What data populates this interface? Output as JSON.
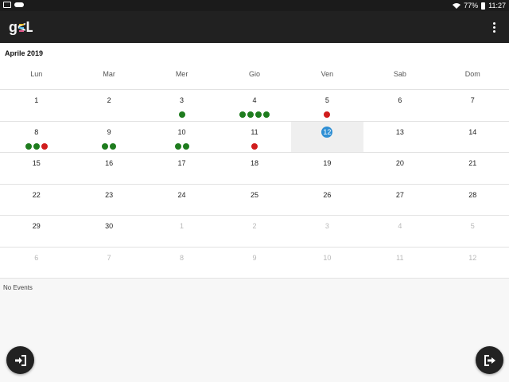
{
  "status_bar": {
    "battery": "77%",
    "time": "11:27",
    "icons": [
      "image-icon",
      "cloud-icon",
      "wifi-icon",
      "battery-icon"
    ]
  },
  "toolbar": {
    "logo_text": "g<L",
    "logo_colors": [
      "#f2c230",
      "#4db6e5",
      "#e85b8e"
    ],
    "menu_icon": "more-vertical-icon"
  },
  "calendar": {
    "month_title": "Aprile 2019",
    "weekdays": [
      "Lun",
      "Mar",
      "Mer",
      "Gio",
      "Ven",
      "Sab",
      "Dom"
    ],
    "today_color": "#2f8fd4",
    "event_colors": {
      "green": "#1e7c1e",
      "red": "#d01c1c"
    },
    "weeks": [
      [
        {
          "day": "1",
          "dots": []
        },
        {
          "day": "2",
          "dots": []
        },
        {
          "day": "3",
          "dots": [
            "green"
          ]
        },
        {
          "day": "4",
          "dots": [
            "green",
            "green",
            "green",
            "green"
          ]
        },
        {
          "day": "5",
          "dots": [
            "red"
          ]
        },
        {
          "day": "6",
          "dots": []
        },
        {
          "day": "7",
          "dots": []
        }
      ],
      [
        {
          "day": "8",
          "dots": [
            "green",
            "green",
            "red"
          ]
        },
        {
          "day": "9",
          "dots": [
            "green",
            "green"
          ]
        },
        {
          "day": "10",
          "dots": [
            "green",
            "green"
          ]
        },
        {
          "day": "11",
          "dots": [
            "red"
          ]
        },
        {
          "day": "12",
          "dots": [],
          "today": true,
          "selected": true
        },
        {
          "day": "13",
          "dots": []
        },
        {
          "day": "14",
          "dots": []
        }
      ],
      [
        {
          "day": "15",
          "dots": []
        },
        {
          "day": "16",
          "dots": []
        },
        {
          "day": "17",
          "dots": []
        },
        {
          "day": "18",
          "dots": []
        },
        {
          "day": "19",
          "dots": []
        },
        {
          "day": "20",
          "dots": []
        },
        {
          "day": "21",
          "dots": []
        }
      ],
      [
        {
          "day": "22",
          "dots": []
        },
        {
          "day": "23",
          "dots": []
        },
        {
          "day": "24",
          "dots": []
        },
        {
          "day": "25",
          "dots": []
        },
        {
          "day": "26",
          "dots": []
        },
        {
          "day": "27",
          "dots": []
        },
        {
          "day": "28",
          "dots": []
        }
      ],
      [
        {
          "day": "29",
          "dots": []
        },
        {
          "day": "30",
          "dots": []
        },
        {
          "day": "1",
          "dots": [],
          "other_month": true
        },
        {
          "day": "2",
          "dots": [],
          "other_month": true
        },
        {
          "day": "3",
          "dots": [],
          "other_month": true
        },
        {
          "day": "4",
          "dots": [],
          "other_month": true
        },
        {
          "day": "5",
          "dots": [],
          "other_month": true
        }
      ],
      [
        {
          "day": "6",
          "dots": [],
          "other_month": true
        },
        {
          "day": "7",
          "dots": [],
          "other_month": true
        },
        {
          "day": "8",
          "dots": [],
          "other_month": true
        },
        {
          "day": "9",
          "dots": [],
          "other_month": true
        },
        {
          "day": "10",
          "dots": [],
          "other_month": true
        },
        {
          "day": "11",
          "dots": [],
          "other_month": true
        },
        {
          "day": "12",
          "dots": [],
          "other_month": true
        }
      ]
    ]
  },
  "events": {
    "empty_text": "No Events"
  },
  "fabs": {
    "left_icon": "login-icon",
    "right_icon": "logout-icon"
  }
}
